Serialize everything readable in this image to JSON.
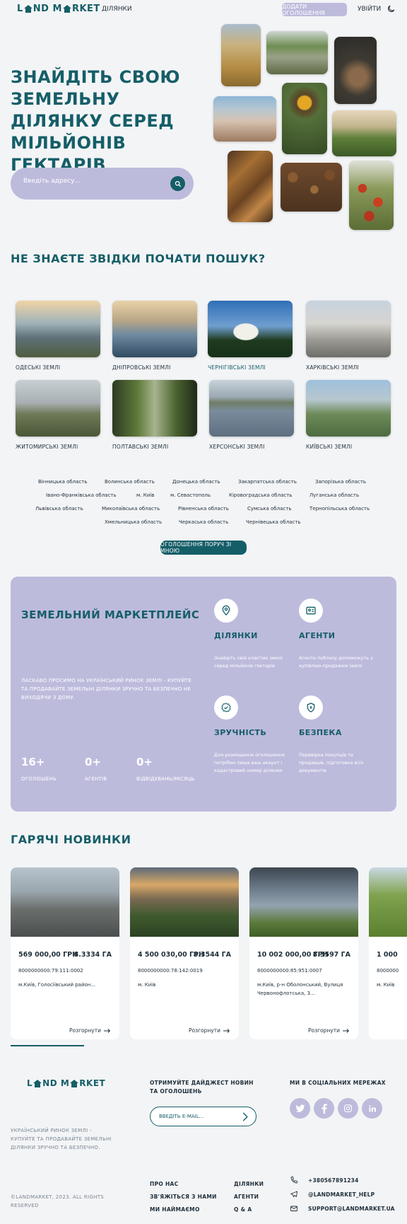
{
  "header": {
    "logo": "LAND MARKET",
    "nav_plots": "ДІЛЯНКИ",
    "add_listing": "ДОДАТИ ОГОЛОШЕННЯ",
    "login": "УВІЙТИ"
  },
  "hero": {
    "title": "ЗНАЙДІТЬ СВОЮ ЗЕМЕЛЬНУ ДІЛЯНКУ СЕРЕД МІЛЬЙОНІВ ГЕКТАРІВ",
    "search_placeholder": "Введіть адресу..."
  },
  "regions": {
    "title": "НЕ ЗНАЄТЕ ЗВІДКИ ПОЧАТИ ПОШУК?",
    "items": [
      {
        "label": "ОДЕСЬКІ ЗЕМЛІ"
      },
      {
        "label": "ДНІПРОВСЬКІ ЗЕМЛІ"
      },
      {
        "label": "ЧЕРНІГІВСЬКІ ЗЕМЛІ"
      },
      {
        "label": "ХАРКІВСЬКІ ЗЕМЛІ"
      },
      {
        "label": "ЖИТОМИРСЬКІ ЗЕМЛІ"
      },
      {
        "label": "ПОЛТАВСЬКІ ЗЕМЛІ"
      },
      {
        "label": "ХЕРСОНСЬКІ ЗЕМЛІ"
      },
      {
        "label": "КИЇВСЬКІ ЗЕМЛІ"
      }
    ],
    "oblasts": [
      "Вінницька область",
      "Волинська область",
      "Донецька область",
      "Закарпатська область",
      "Запорізька область",
      "Івано-Франківська область",
      "м. Київ",
      "м. Севастополь",
      "Кіровоградська область",
      "Луганська область",
      "Львівська область",
      "Миколаївська область",
      "Рівненська область",
      "Сумська область",
      "Тернопільська область",
      "Хмельницька область",
      "Черкаська область",
      "Чернівецька область"
    ],
    "near_button": "ОГОЛОШЕННЯ ПОРУЧ ЗІ МНОЮ"
  },
  "market": {
    "title": "ЗЕМЕЛЬНИЙ МАРКЕТПЛЕЙС",
    "description": "ЛАСКАВО ПРОСИМО НА УКРАЇНСЬКИЙ РИНОК ЗЕМЛІ - КУПУЙТЕ ТА ПРОДАВАЙТЕ ЗЕМЕЛЬНІ ДІЛЯНКИ ЗРУЧНО ТА БЕЗПЕЧНО НЕ ВИХОДЯЧИ З ДОМУ.",
    "stats": [
      {
        "value": "16+",
        "label": "ОГОЛОШЕНЬ"
      },
      {
        "value": "0+",
        "label": "АГЕНТІВ"
      },
      {
        "value": "0+",
        "label": "ВІДВІДУВАНЬ/МІСЯЦЬ"
      }
    ],
    "features": [
      {
        "icon": "location-pin-icon",
        "title": "ДІЛЯНКИ",
        "desc": "Знайдіть свій клаптик землі серед мільйонів гектарів"
      },
      {
        "icon": "id-card-icon",
        "title": "АГЕНТИ",
        "desc": "Агенти поблизу допоможуть з купівлею-продажем землі"
      },
      {
        "icon": "badge-check-icon",
        "title": "ЗРУЧНІСТЬ",
        "desc": "Для розміщення оголошення потрібен лише ваш акаунт і кадастровий номер ділянки"
      },
      {
        "icon": "shield-icon",
        "title": "БЕЗПЕКА",
        "desc": "Перевірка покупців та продавців, підготовка всіх документів"
      }
    ]
  },
  "news": {
    "title": "ГАРЯЧІ НОВИНКИ",
    "more_label": "Розгорнути",
    "cards": [
      {
        "price": "569 000,00 ГРН",
        "area": "8.3334 ГА",
        "cadastre": "8000000000:79:111:0002",
        "address": "м.Київ, Голосіївський район..."
      },
      {
        "price": "4 500 030,00 ГРН",
        "area": "8.3544 ГА",
        "cadastre": "8000000000:78:142:0019",
        "address": "м. Київ"
      },
      {
        "price": "10 002 000,00 ГРН",
        "area": "8.3597 ГА",
        "cadastre": "8000000000:85:951:0007",
        "address": "м.Київ, р-н Оболонський, Вулиця Червонофлотська, 3..."
      },
      {
        "price": "1 000",
        "area": "",
        "cadastre": "8000000",
        "address": "м. Київ"
      }
    ]
  },
  "footer": {
    "logo": "LAND MARKET",
    "description": "УКРАЇНСЬКИЙ РИНОК ЗЕМЛІ - КУПУЙТЕ ТА ПРОДАВАЙТЕ ЗЕМЕЛЬНІ ДІЛЯНКИ ЗРУЧНО ТА БЕЗПЕЧНО.",
    "digest_title": "ОТРИМУЙТЕ ДАЙДЖЕСТ НОВИН ТА ОГОЛОШЕНЬ",
    "email_placeholder": "ВВЕДІТЬ E-MAIL...",
    "social_title": "МИ В СОЦІАЛЬНИХ МЕРЕЖАХ",
    "links_col1": [
      "ПРО НАС",
      "ЗВ'ЯЖІТЬСЯ З НАМИ",
      "МИ НАЙМАЄМО"
    ],
    "links_col2": [
      "ДІЛЯНКИ",
      "АГЕНТИ",
      "Q & A"
    ],
    "phone": "+380567891234",
    "telegram": "@LANDMARKET_HELP",
    "email": "SUPPORT@LANDMARKET.UA",
    "copyright": "©LANDMARKET, 2023. ALL RIGHTS RESERVED"
  },
  "colors": {
    "accent": "#155e68",
    "lavender": "#bdbbdc",
    "background": "#f3f4f6"
  }
}
